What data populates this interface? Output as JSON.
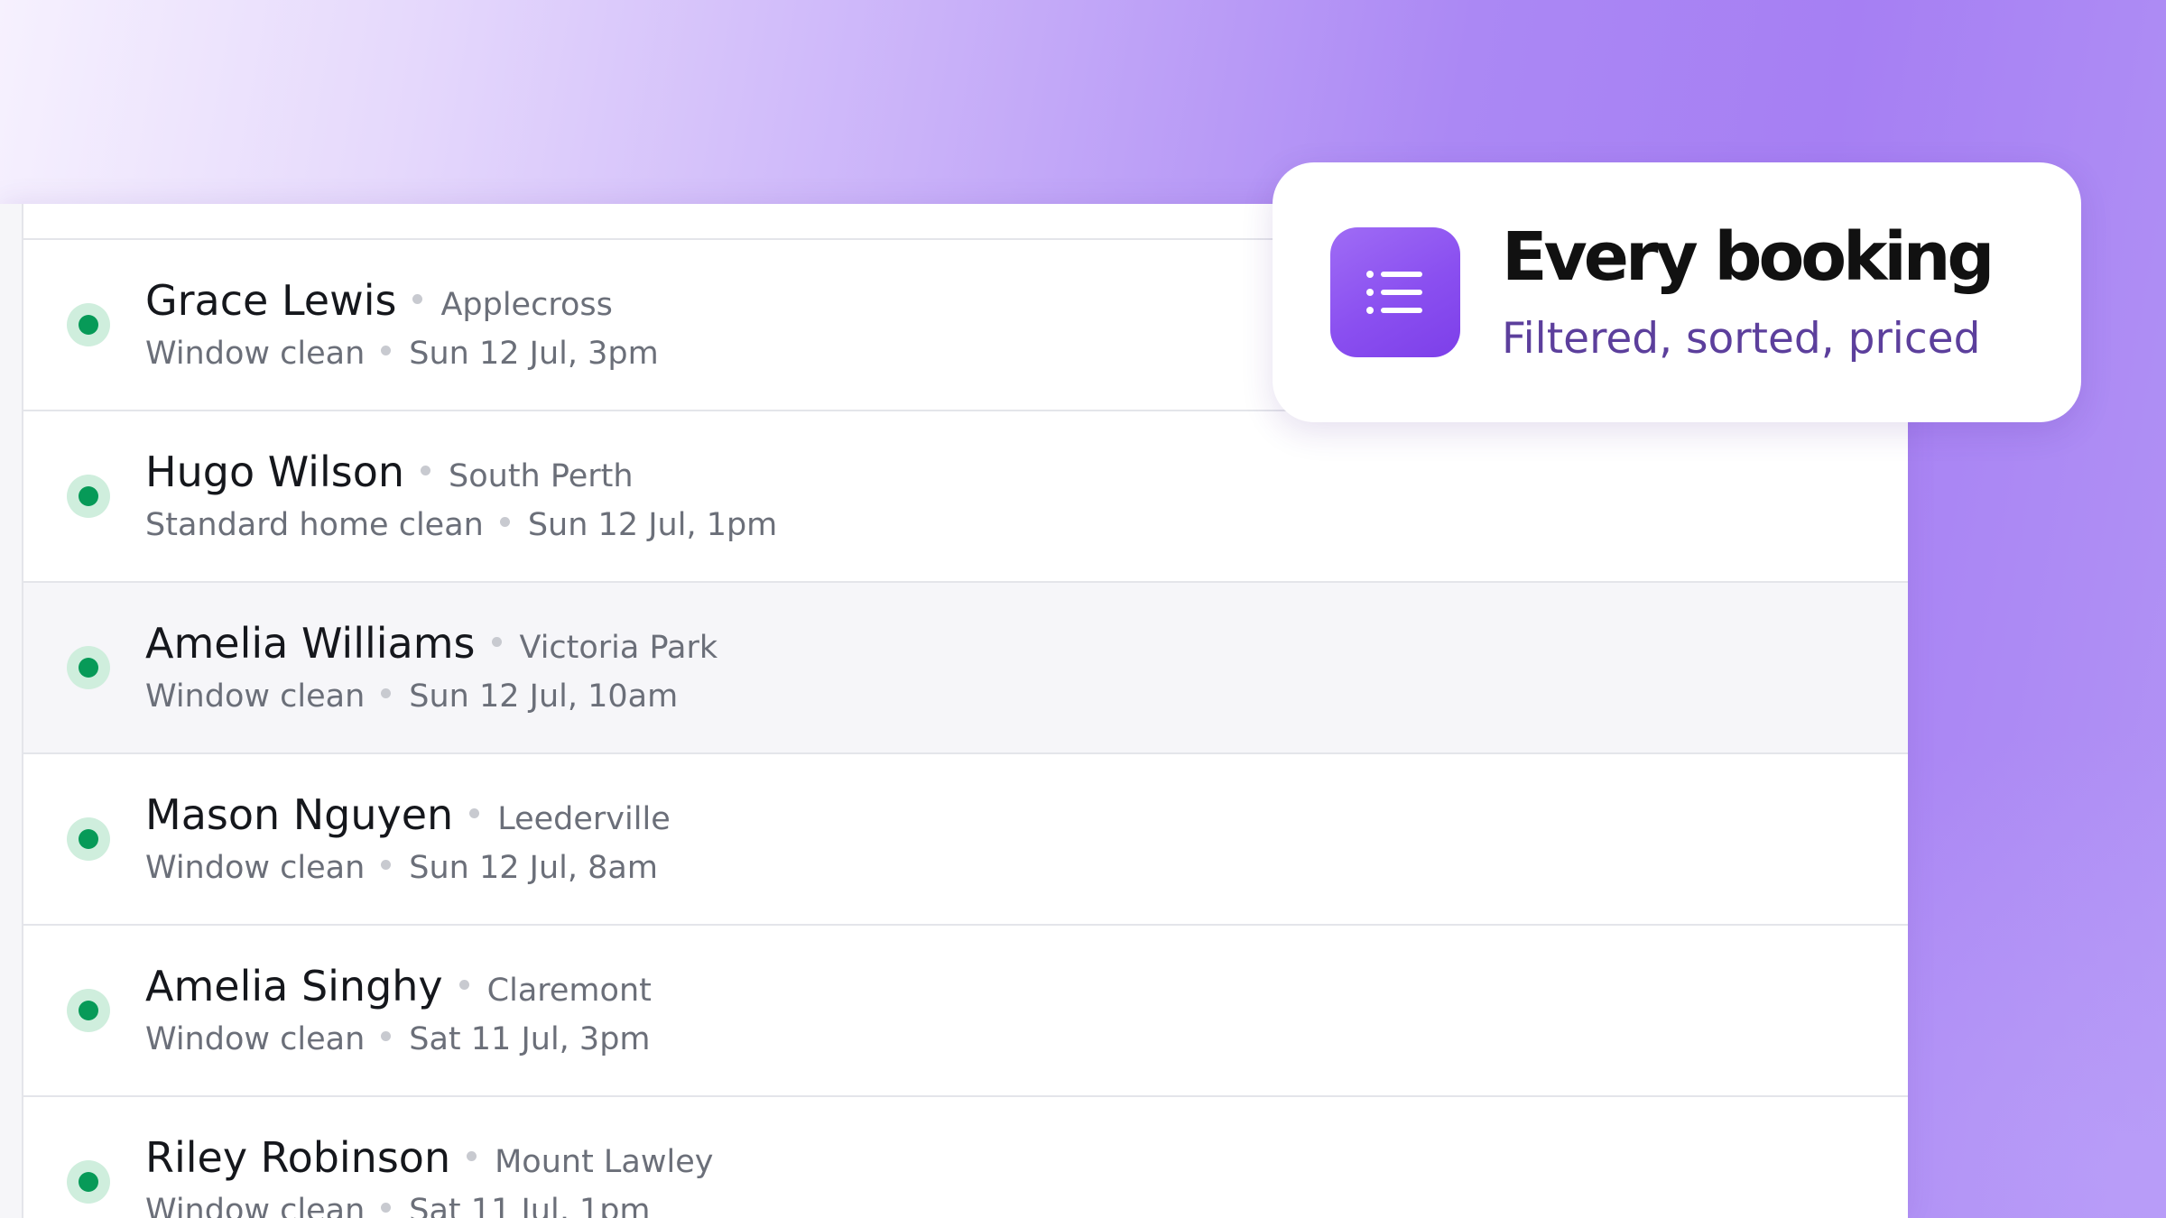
{
  "colors": {
    "accent": "#8b50f0",
    "status_active": "#079a58",
    "status_ring": "#cfeedd",
    "subtitle": "#5c3f9c"
  },
  "callout": {
    "icon": "list-icon",
    "title": "Every booking",
    "subtitle": "Filtered, sorted, priced"
  },
  "bookings": [
    {
      "name": "Grace Lewis",
      "suburb": "Applecross",
      "service": "Window clean",
      "datetime": "Sun 12 Jul, 3pm",
      "status": "active"
    },
    {
      "name": "Hugo Wilson",
      "suburb": "South Perth",
      "service": "Standard home clean",
      "datetime": "Sun 12 Jul, 1pm",
      "status": "active"
    },
    {
      "name": "Amelia Williams",
      "suburb": "Victoria Park",
      "service": "Window clean",
      "datetime": "Sun 12 Jul, 10am",
      "status": "active"
    },
    {
      "name": "Mason Nguyen",
      "suburb": "Leederville",
      "service": "Window clean",
      "datetime": "Sun 12 Jul, 8am",
      "status": "active"
    },
    {
      "name": "Amelia Singhy",
      "suburb": "Claremont",
      "service": "Window clean",
      "datetime": "Sat 11 Jul, 3pm",
      "status": "active"
    },
    {
      "name": "Riley Robinson",
      "suburb": "Mount Lawley",
      "service": "Window clean",
      "datetime": "Sat 11 Jul, 1pm",
      "status": "active"
    }
  ]
}
